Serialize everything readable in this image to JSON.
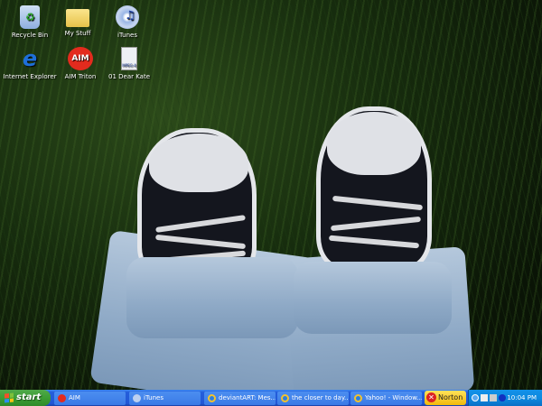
{
  "desktop": {
    "icons": [
      {
        "label": "Recycle Bin",
        "icon": "recycle-bin-icon"
      },
      {
        "label": "My Stuff",
        "icon": "folder-icon"
      },
      {
        "label": "iTunes",
        "icon": "itunes-icon"
      },
      {
        "label": "Internet Explorer",
        "icon": "internet-explorer-icon"
      },
      {
        "label": "AIM Triton",
        "icon": "aim-icon",
        "glyph": "AIM"
      },
      {
        "label": "01 Dear Kate",
        "icon": "mpeg4-file-icon",
        "glyph": "MPEG-4"
      }
    ]
  },
  "taskbar": {
    "start_label": "start",
    "tasks": [
      {
        "label": "AIM",
        "icon": "aim-icon"
      },
      {
        "label": "iTunes",
        "icon": "itunes-icon"
      },
      {
        "label": "deviantART: Mes...",
        "icon": "internet-explorer-icon"
      },
      {
        "label": "the closer to day...",
        "icon": "internet-explorer-icon"
      },
      {
        "label": "Yahoo! - Window...",
        "icon": "internet-explorer-icon"
      }
    ],
    "norton_label": "Norton",
    "clock": "10:04 PM"
  }
}
